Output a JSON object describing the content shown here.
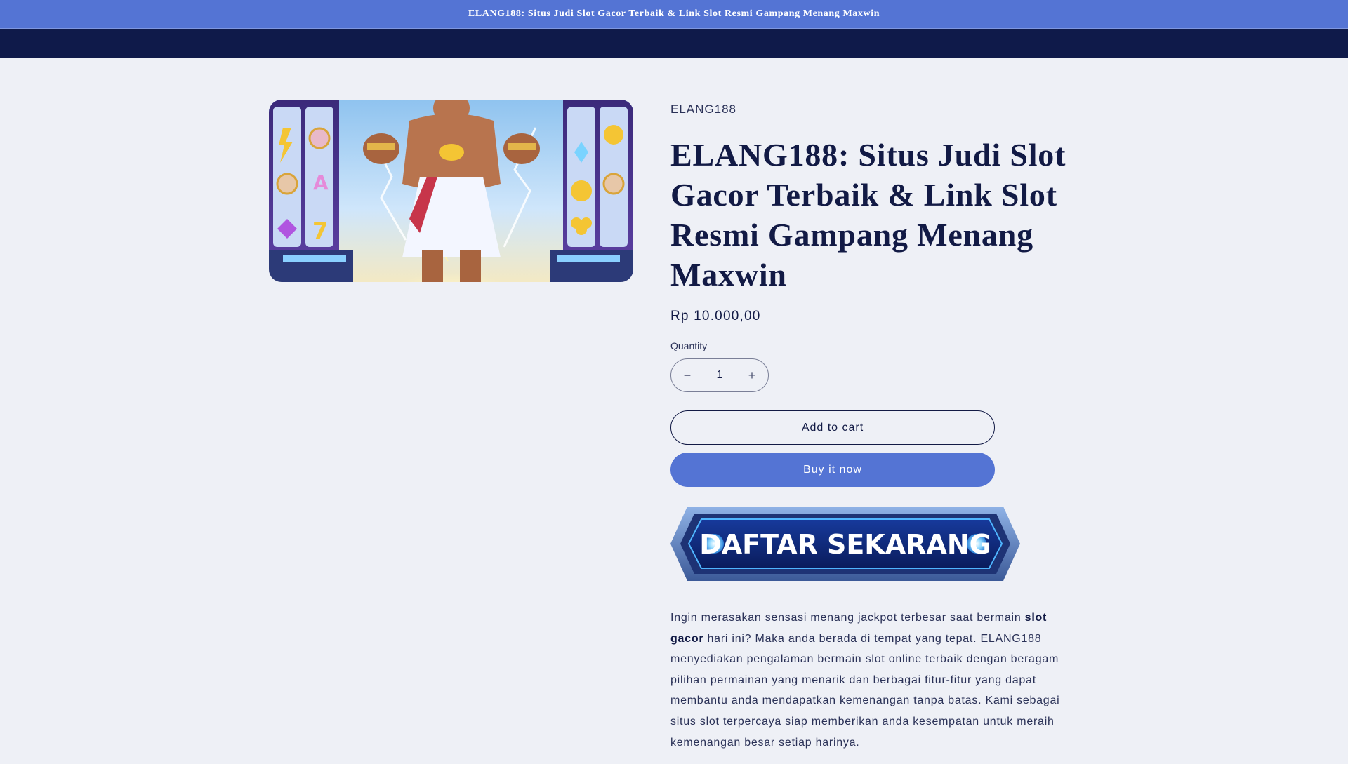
{
  "announcement": {
    "text": "ELANG188: Situs Judi Slot Gacor Terbaik & Link Slot Resmi Gampang Menang Maxwin"
  },
  "product": {
    "vendor": "ELANG188",
    "title": "ELANG188: Situs Judi Slot Gacor Terbaik & Link Slot Resmi Gampang Menang Maxwin",
    "price": "Rp 10.000,00",
    "quantity_label": "Quantity",
    "quantity_value": "1",
    "decrease_symbol": "−",
    "increase_symbol": "+",
    "add_to_cart_label": "Add to cart",
    "buy_now_label": "Buy it now",
    "banner_text": "DAFTAR SEKARANG",
    "description": {
      "before_link": "Ingin merasakan sensasi menang jackpot terbesar saat bermain ",
      "link_text": "slot gacor",
      "after_link": " hari ini? Maka anda berada di tempat yang tepat. ELANG188 menyediakan pengalaman bermain slot online terbaik dengan beragam pilihan permainan yang menarik dan berbagai fitur-fitur yang dapat membantu anda mendapatkan kemenangan tanpa batas. Kami sebagai situs slot terpercaya siap memberikan anda kesempatan untuk meraih kemenangan besar setiap harinya."
    }
  },
  "colors": {
    "announcement_bg": "#5474d4",
    "navbar_bg": "#0f1a4a",
    "page_bg": "#eef0f6",
    "text": "#121a45",
    "buy_button": "#5474d4"
  }
}
